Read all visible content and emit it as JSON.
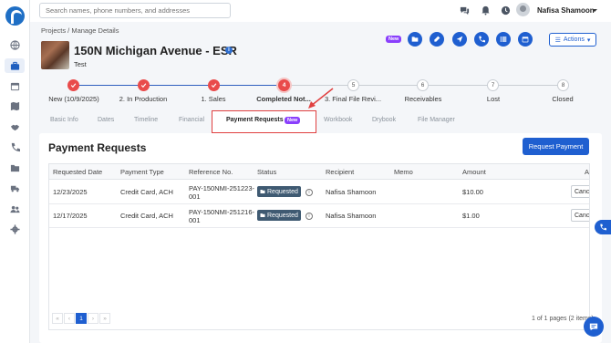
{
  "topbar": {
    "search_placeholder": "Search names, phone numbers, and addresses",
    "user_name": "Nafisa Shamoon"
  },
  "breadcrumb": "Projects / Manage Details",
  "project": {
    "title": "150N Michigan Avenue - ESR",
    "subtitle": "Test",
    "info": "i"
  },
  "header_actions": {
    "new_badge": "New",
    "actions_label": "Actions"
  },
  "stepper": [
    {
      "label": "New (10/9/2025)",
      "state": "done"
    },
    {
      "label": "2. In Production",
      "state": "done"
    },
    {
      "label": "1. Sales",
      "state": "done"
    },
    {
      "label": "Completed Not...",
      "state": "current",
      "number": "4"
    },
    {
      "label": "3. Final File Revi...",
      "state": "todo",
      "number": "5"
    },
    {
      "label": "Receivables",
      "state": "todo",
      "number": "6"
    },
    {
      "label": "Lost",
      "state": "todo",
      "number": "7"
    },
    {
      "label": "Closed",
      "state": "todo",
      "number": "8"
    }
  ],
  "tabs": {
    "basic_info": "Basic Info",
    "dates": "Dates",
    "timeline": "Timeline",
    "financial": "Financial",
    "payment_requests": "Payment Requests",
    "payment_requests_badge": "New",
    "workbook": "Workbook",
    "drybook": "Drybook",
    "file_manager": "File Manager"
  },
  "payment_requests": {
    "title": "Payment Requests",
    "request_button": "Request Payment",
    "columns": [
      "Requested Date",
      "Payment Type",
      "Reference No.",
      "Status",
      "Recipient",
      "Memo",
      "Amount",
      "A"
    ],
    "rows": [
      {
        "date": "12/23/2025",
        "type": "Credit Card, ACH",
        "ref_line1": "PAY-150NMI-251223-",
        "ref_line2": "001",
        "status": "Requested",
        "recipient": "Nafisa Shamoon",
        "memo": "",
        "amount": "$10.00",
        "action": "Canc"
      },
      {
        "date": "12/17/2025",
        "type": "Credit Card, ACH",
        "ref_line1": "PAY-150NMI-251216-",
        "ref_line2": "001",
        "status": "Requested",
        "recipient": "Nafisa Shamoon",
        "memo": "",
        "amount": "$1.00",
        "action": "Canc"
      }
    ],
    "pagination": {
      "first": "«",
      "prev": "‹",
      "current": "1",
      "next": "›",
      "last": "»",
      "info": "1 of 1 pages (2 items)"
    }
  },
  "colors": {
    "primary": "#1f5fd0",
    "step_done": "#e94b4b",
    "badge_new": "#8a3ffc",
    "annotation": "#e04040",
    "status_pill": "#3f5a72"
  }
}
